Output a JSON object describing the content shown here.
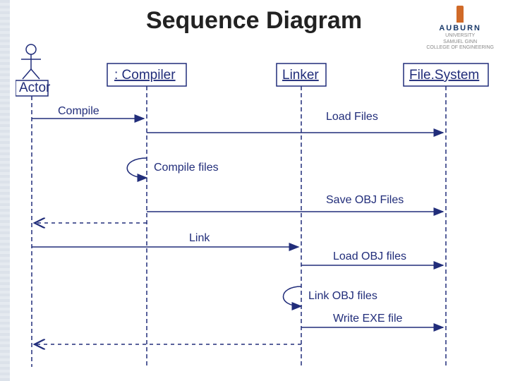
{
  "title": "Sequence Diagram",
  "logo": {
    "name": "AUBURN",
    "subtitle1": "UNIVERSITY",
    "subtitle2": "SAMUEL GINN",
    "subtitle3": "COLLEGE OF ENGINEERING"
  },
  "actor_label": "Actor",
  "objects": {
    "compiler": ": Compiler",
    "linker": "Linker",
    "filesystem": "File.System"
  },
  "messages": {
    "compile": "Compile",
    "load_files": "Load Files",
    "compile_files": "Compile files",
    "save_obj": "Save OBJ Files",
    "link": "Link",
    "load_obj": "Load OBJ files",
    "link_obj": "Link OBJ files",
    "write_exe": "Write EXE file"
  }
}
